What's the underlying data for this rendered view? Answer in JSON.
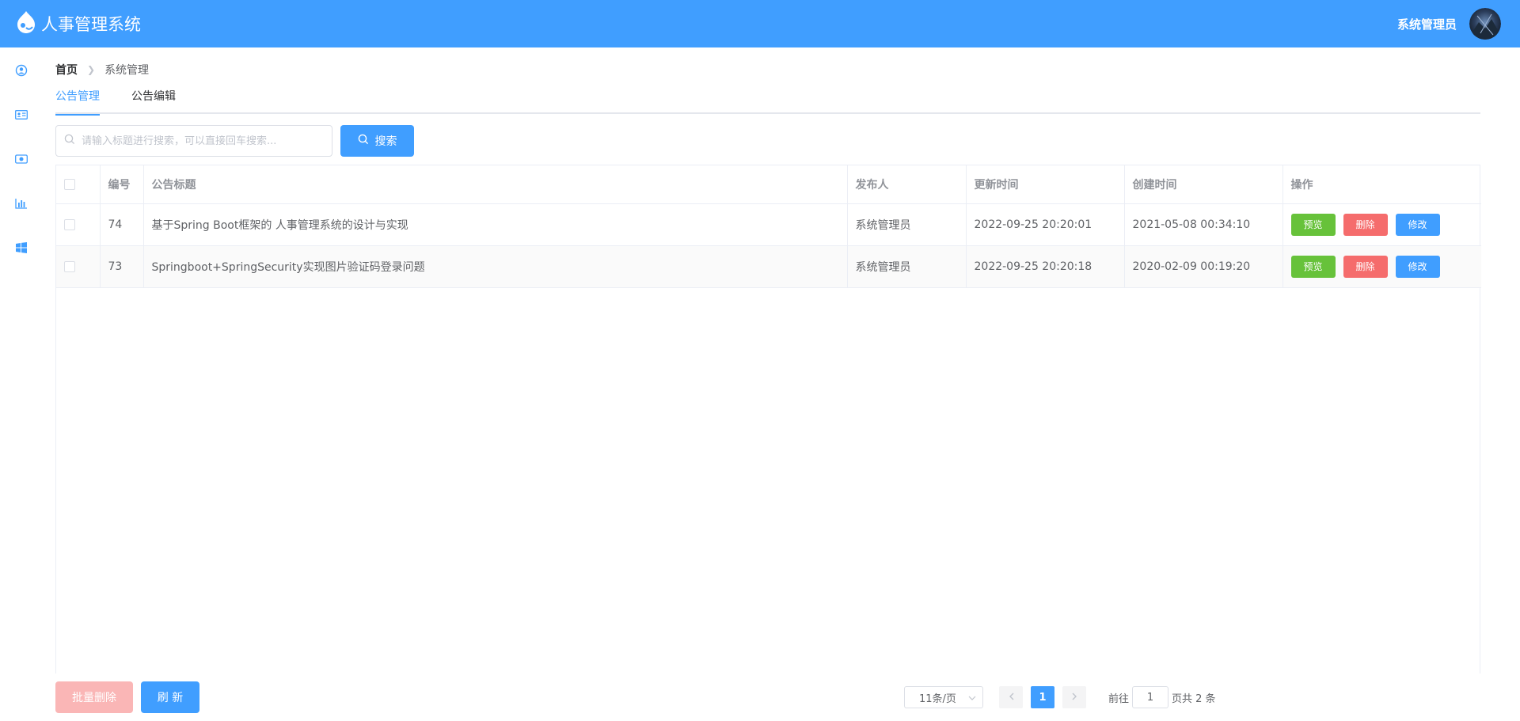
{
  "header": {
    "title": "人事管理系统",
    "user_name": "系统管理员",
    "brand_color": "#409eff"
  },
  "sidebar": {
    "items": [
      {
        "icon": "user-circle-icon"
      },
      {
        "icon": "id-card-icon"
      },
      {
        "icon": "eye-icon"
      },
      {
        "icon": "bar-chart-icon"
      },
      {
        "icon": "windows-icon"
      }
    ]
  },
  "breadcrumb": {
    "home": "首页",
    "current": "系统管理"
  },
  "tabs": [
    {
      "label": "公告管理",
      "active": true
    },
    {
      "label": "公告编辑",
      "active": false
    }
  ],
  "search": {
    "placeholder": "请输入标题进行搜索，可以直接回车搜索...",
    "value": "",
    "button_label": "搜索"
  },
  "table": {
    "headers": [
      "编号",
      "公告标题",
      "发布人",
      "更新时间",
      "创建时间",
      "操作"
    ],
    "rows": [
      {
        "id": "74",
        "title": "基于Spring Boot框架的 人事管理系统的设计与实现",
        "publisher": "系统管理员",
        "updated": "2022-09-25 20:20:01",
        "created": "2021-05-08 00:34:10"
      },
      {
        "id": "73",
        "title": "Springboot+SpringSecurity实现图片验证码登录问题",
        "publisher": "系统管理员",
        "updated": "2022-09-25 20:20:18",
        "created": "2020-02-09 00:19:20"
      }
    ],
    "actions": {
      "preview": "预览",
      "delete": "删除",
      "edit": "修改"
    },
    "action_colors": {
      "preview": "#67c23a",
      "delete": "#f56c6c",
      "edit": "#409eff"
    }
  },
  "footer": {
    "batch_delete_label": "批量删除",
    "refresh_label": "刷 新",
    "page_size": "11条/页",
    "current_page": "1",
    "goto_label": "前往",
    "goto_value": "1",
    "total_label": "页共 2 条"
  }
}
